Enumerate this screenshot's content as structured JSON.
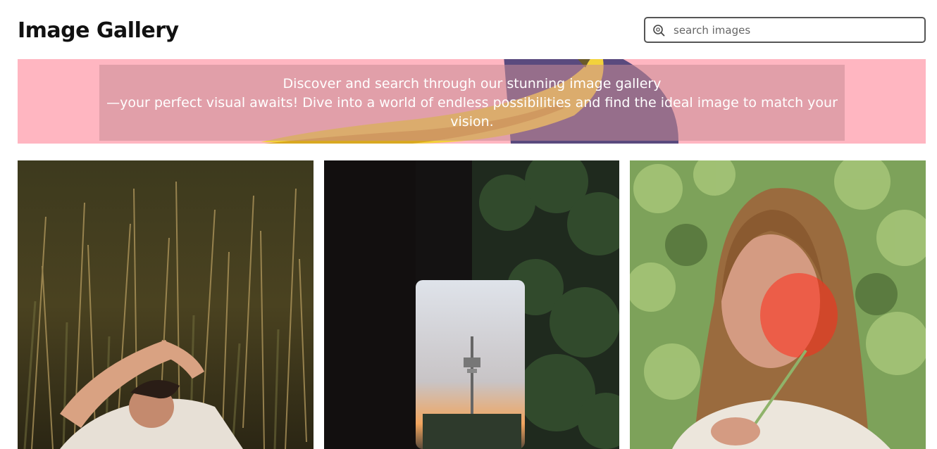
{
  "header": {
    "title": "Image Gallery"
  },
  "search": {
    "placeholder": "search images",
    "value": "",
    "icon": "search-icon"
  },
  "banner": {
    "line1": "Discover and search through our stunning image gallery",
    "line2": "—your perfect visual awaits! Dive into a world of endless possibilities and find the ideal image to match your",
    "line3": "vision.",
    "background_color": "#ffb6c1"
  },
  "gallery": {
    "images": [
      {
        "subject": "woman-lying-in-tall-grass"
      },
      {
        "subject": "tv-tower-through-window"
      },
      {
        "subject": "woman-portrait-with-red-light"
      }
    ]
  }
}
